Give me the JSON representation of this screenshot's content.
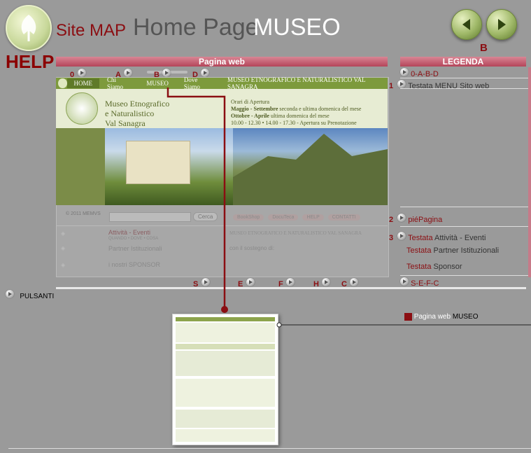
{
  "header": {
    "help": "HELP",
    "site_map": "Site MAP",
    "home_page": "Home Page",
    "museo": "MUSEO",
    "b_label": "B"
  },
  "bars": {
    "pagina_web": "Pagina web",
    "legenda": "LEGENDA"
  },
  "markers": {
    "m0": "0",
    "mA": "A",
    "mB": "B",
    "mD": "D",
    "mS": "S",
    "mE": "E",
    "mF": "F",
    "mH": "H",
    "mC": "C"
  },
  "web": {
    "nav": [
      "HOME",
      "Chi Siamo",
      "MUSEO",
      "Dove Siamo",
      "MUSEO ETNOGRAFICO E NATURALISTICO VAL SANAGRA"
    ],
    "logo_lines": [
      "Museo Etnografico",
      "e Naturalistico",
      "Val Sanagra"
    ],
    "orari_title": "Orari di Apertura",
    "orari_1_b": "Maggio - Settembre",
    "orari_1": " seconda e ultima domenica del mese",
    "orari_2_b": "Ottobre - Aprile",
    "orari_2": " ultima domenica del mese",
    "orari_3": "10.00 - 12.30 • 14.00 - 17.30 - Apertura su Prenotazione",
    "copyright": "© 2011 MEMVS",
    "search_btn": "Cerca",
    "footer_btns": [
      "BookShop",
      "DocuTeca",
      "HELP",
      "CONTATTI"
    ],
    "attivita": "Attività - Eventi",
    "attivita_sub": "QUANDO • DOVE • COSA",
    "museo_line": "MUSEO ETNOGRAFICO E NATURALISTICO VAL SANAGRA",
    "partner": "Partner Istituzionali",
    "sostegno": "con il sostegno di:",
    "sponsor": "i nostri SPONSOR"
  },
  "legend": {
    "r0": "0-A-B-D",
    "r1_num": "1",
    "r1_a": "Testata ",
    "r1_b": "MENU Sito web",
    "r2_num": "2",
    "r2": "piéPagina",
    "r3_num": "3",
    "r3_a": "Testata",
    "r3_b": " Attività - Eventi",
    "r4_a": "Testata",
    "r4_b": " Partner Istituzionali",
    "r5_a": "Testata",
    "r5_b": " Sponsor",
    "r6": "S-E-F-C"
  },
  "pulsanti": "PULSANTI",
  "pagina_link": {
    "a": "Pagina web ",
    "b": "MUSEO"
  },
  "colors": {
    "accent": "#8b0e12",
    "web_green": "#7d9a3c",
    "bar": "#c25a6c"
  }
}
